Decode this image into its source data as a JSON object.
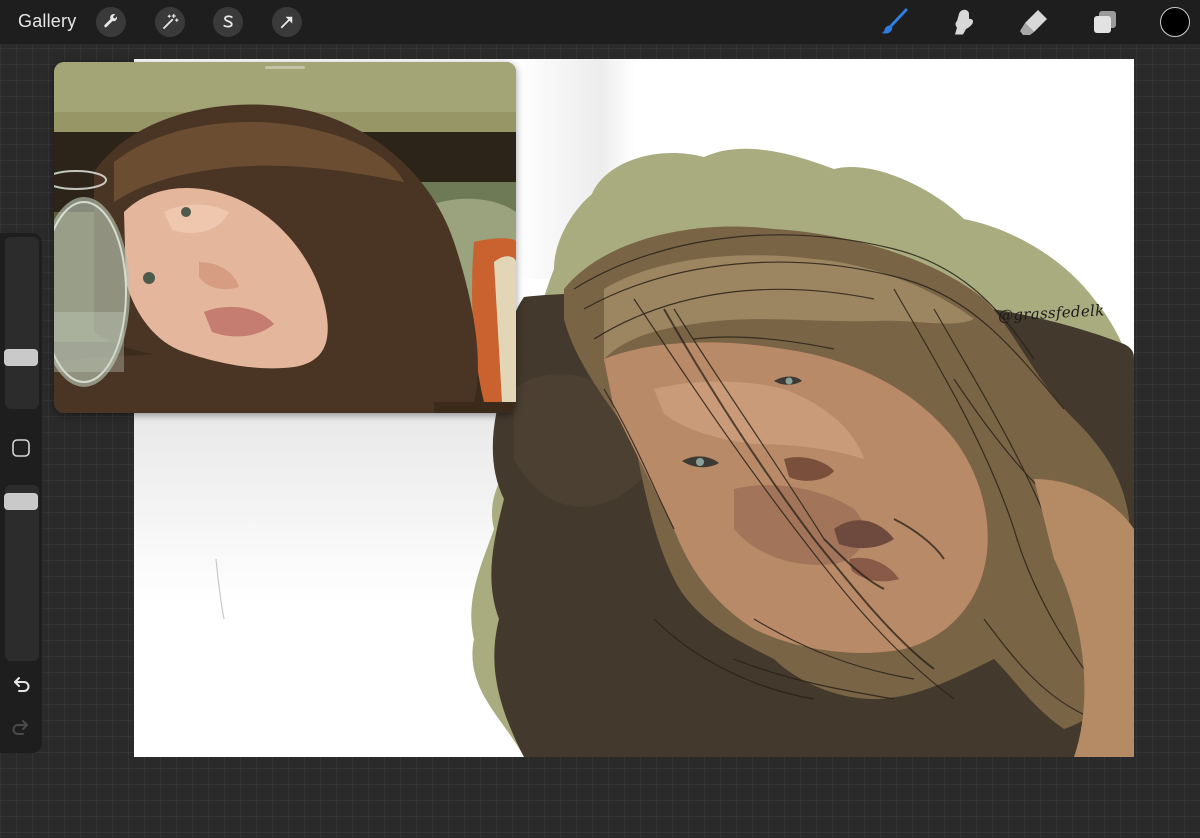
{
  "topbar": {
    "gallery_label": "Gallery",
    "left_tools": [
      {
        "icon": "wrench-icon",
        "tool": "actions"
      },
      {
        "icon": "magic-wand-icon",
        "tool": "adjustments"
      },
      {
        "icon": "selection-s-icon",
        "tool": "selection"
      },
      {
        "icon": "transform-arrow-icon",
        "tool": "transform"
      }
    ],
    "right_tools": [
      {
        "icon": "brush-icon",
        "tool": "paint",
        "active": true
      },
      {
        "icon": "smudge-icon",
        "tool": "smudge"
      },
      {
        "icon": "eraser-icon",
        "tool": "erase"
      },
      {
        "icon": "layers-icon",
        "tool": "layers"
      }
    ],
    "current_color": "#000000",
    "active_tool_color": "#2f7de1"
  },
  "sidebar": {
    "brush_size_level": 0.28,
    "brush_opacity_level": 0.95,
    "modify_button_icon": "square-modifier-icon",
    "undo_icon": "undo-icon",
    "redo_icon": "redo-icon",
    "redo_enabled": false
  },
  "canvas": {
    "background": "#ffffff",
    "watermark": "@grassfedelk"
  },
  "reference_window": {
    "visible": true
  }
}
